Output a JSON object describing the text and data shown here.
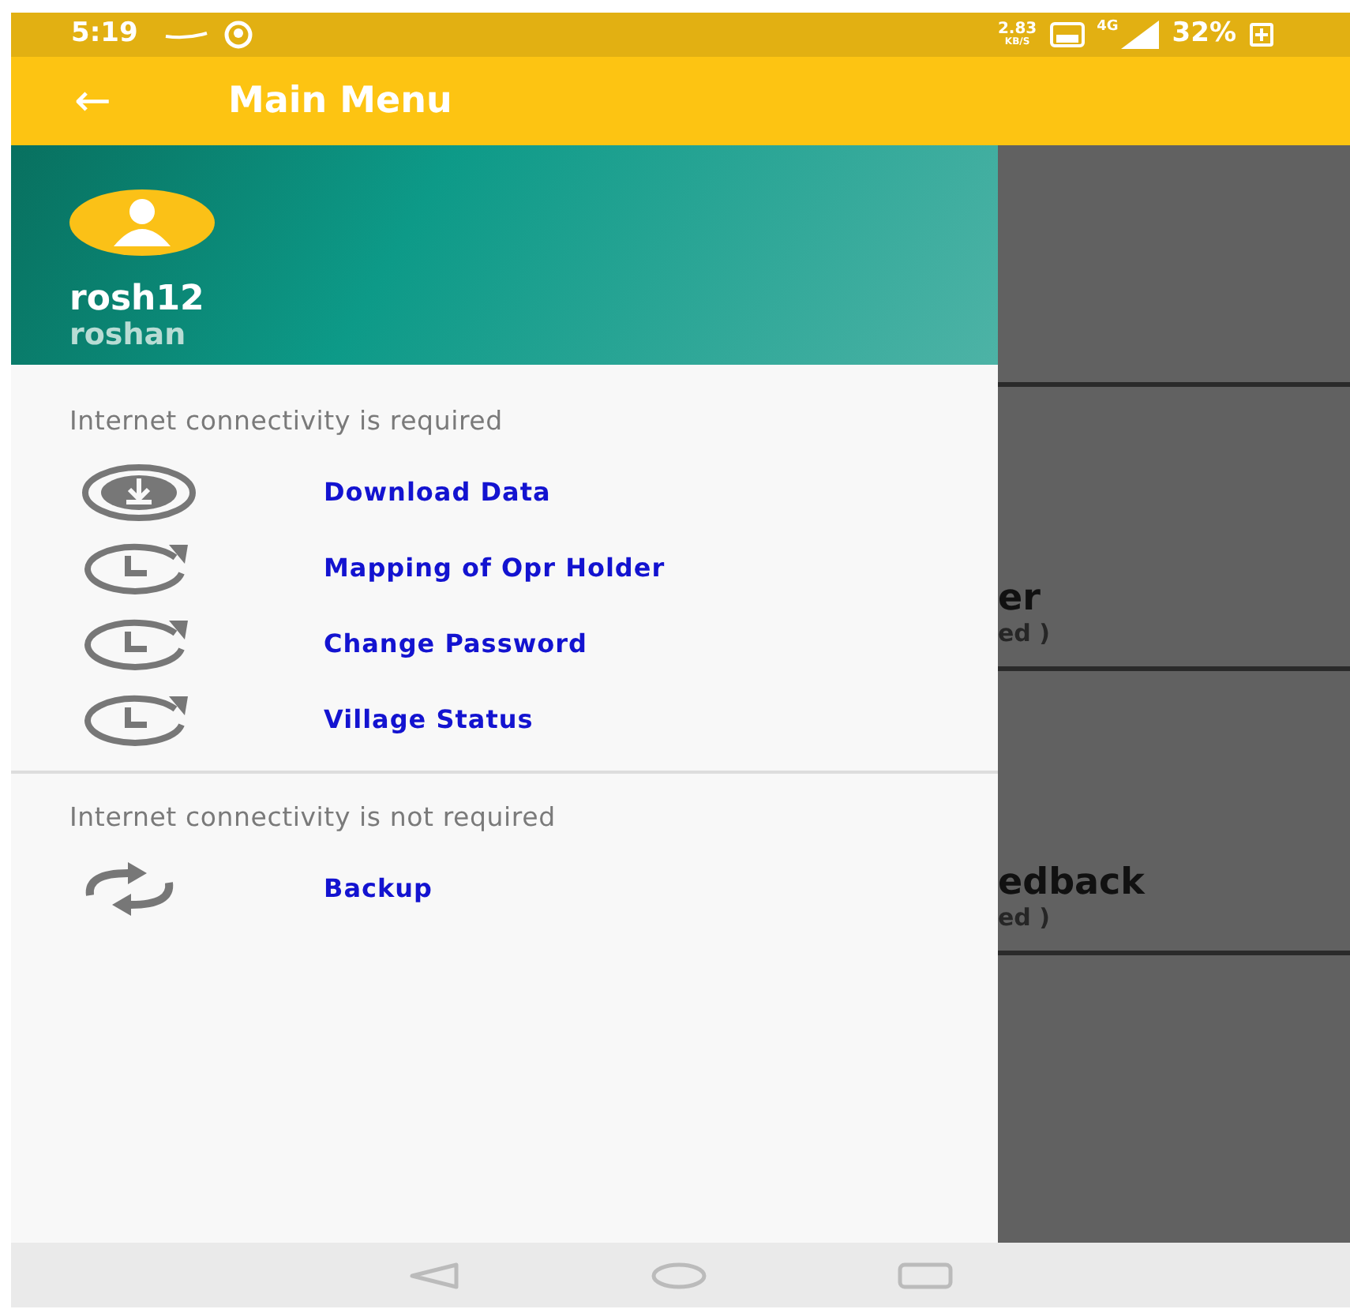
{
  "status_bar": {
    "time": "5:19",
    "speed": "2.83",
    "speed_unit": "KB/S",
    "network": "4G",
    "battery": "32%"
  },
  "app_bar": {
    "back": "←",
    "title": "Main Menu"
  },
  "drawer": {
    "user_id": "rosh12",
    "user_name": "roshan",
    "sections": [
      {
        "label": "Internet connectivity is required",
        "items": [
          {
            "kind": "download",
            "label": "Download Data"
          },
          {
            "kind": "history",
            "label": "Mapping of Opr Holder"
          },
          {
            "kind": "history",
            "label": "Change Password"
          },
          {
            "kind": "history",
            "label": "Village Status"
          }
        ]
      },
      {
        "label": "Internet connectivity is not required",
        "items": [
          {
            "kind": "sync",
            "label": "Backup"
          }
        ]
      }
    ]
  },
  "background_cards": [
    {
      "title": "er",
      "subtitle": "ed )"
    },
    {
      "title": "edback",
      "subtitle": "ed )"
    }
  ]
}
